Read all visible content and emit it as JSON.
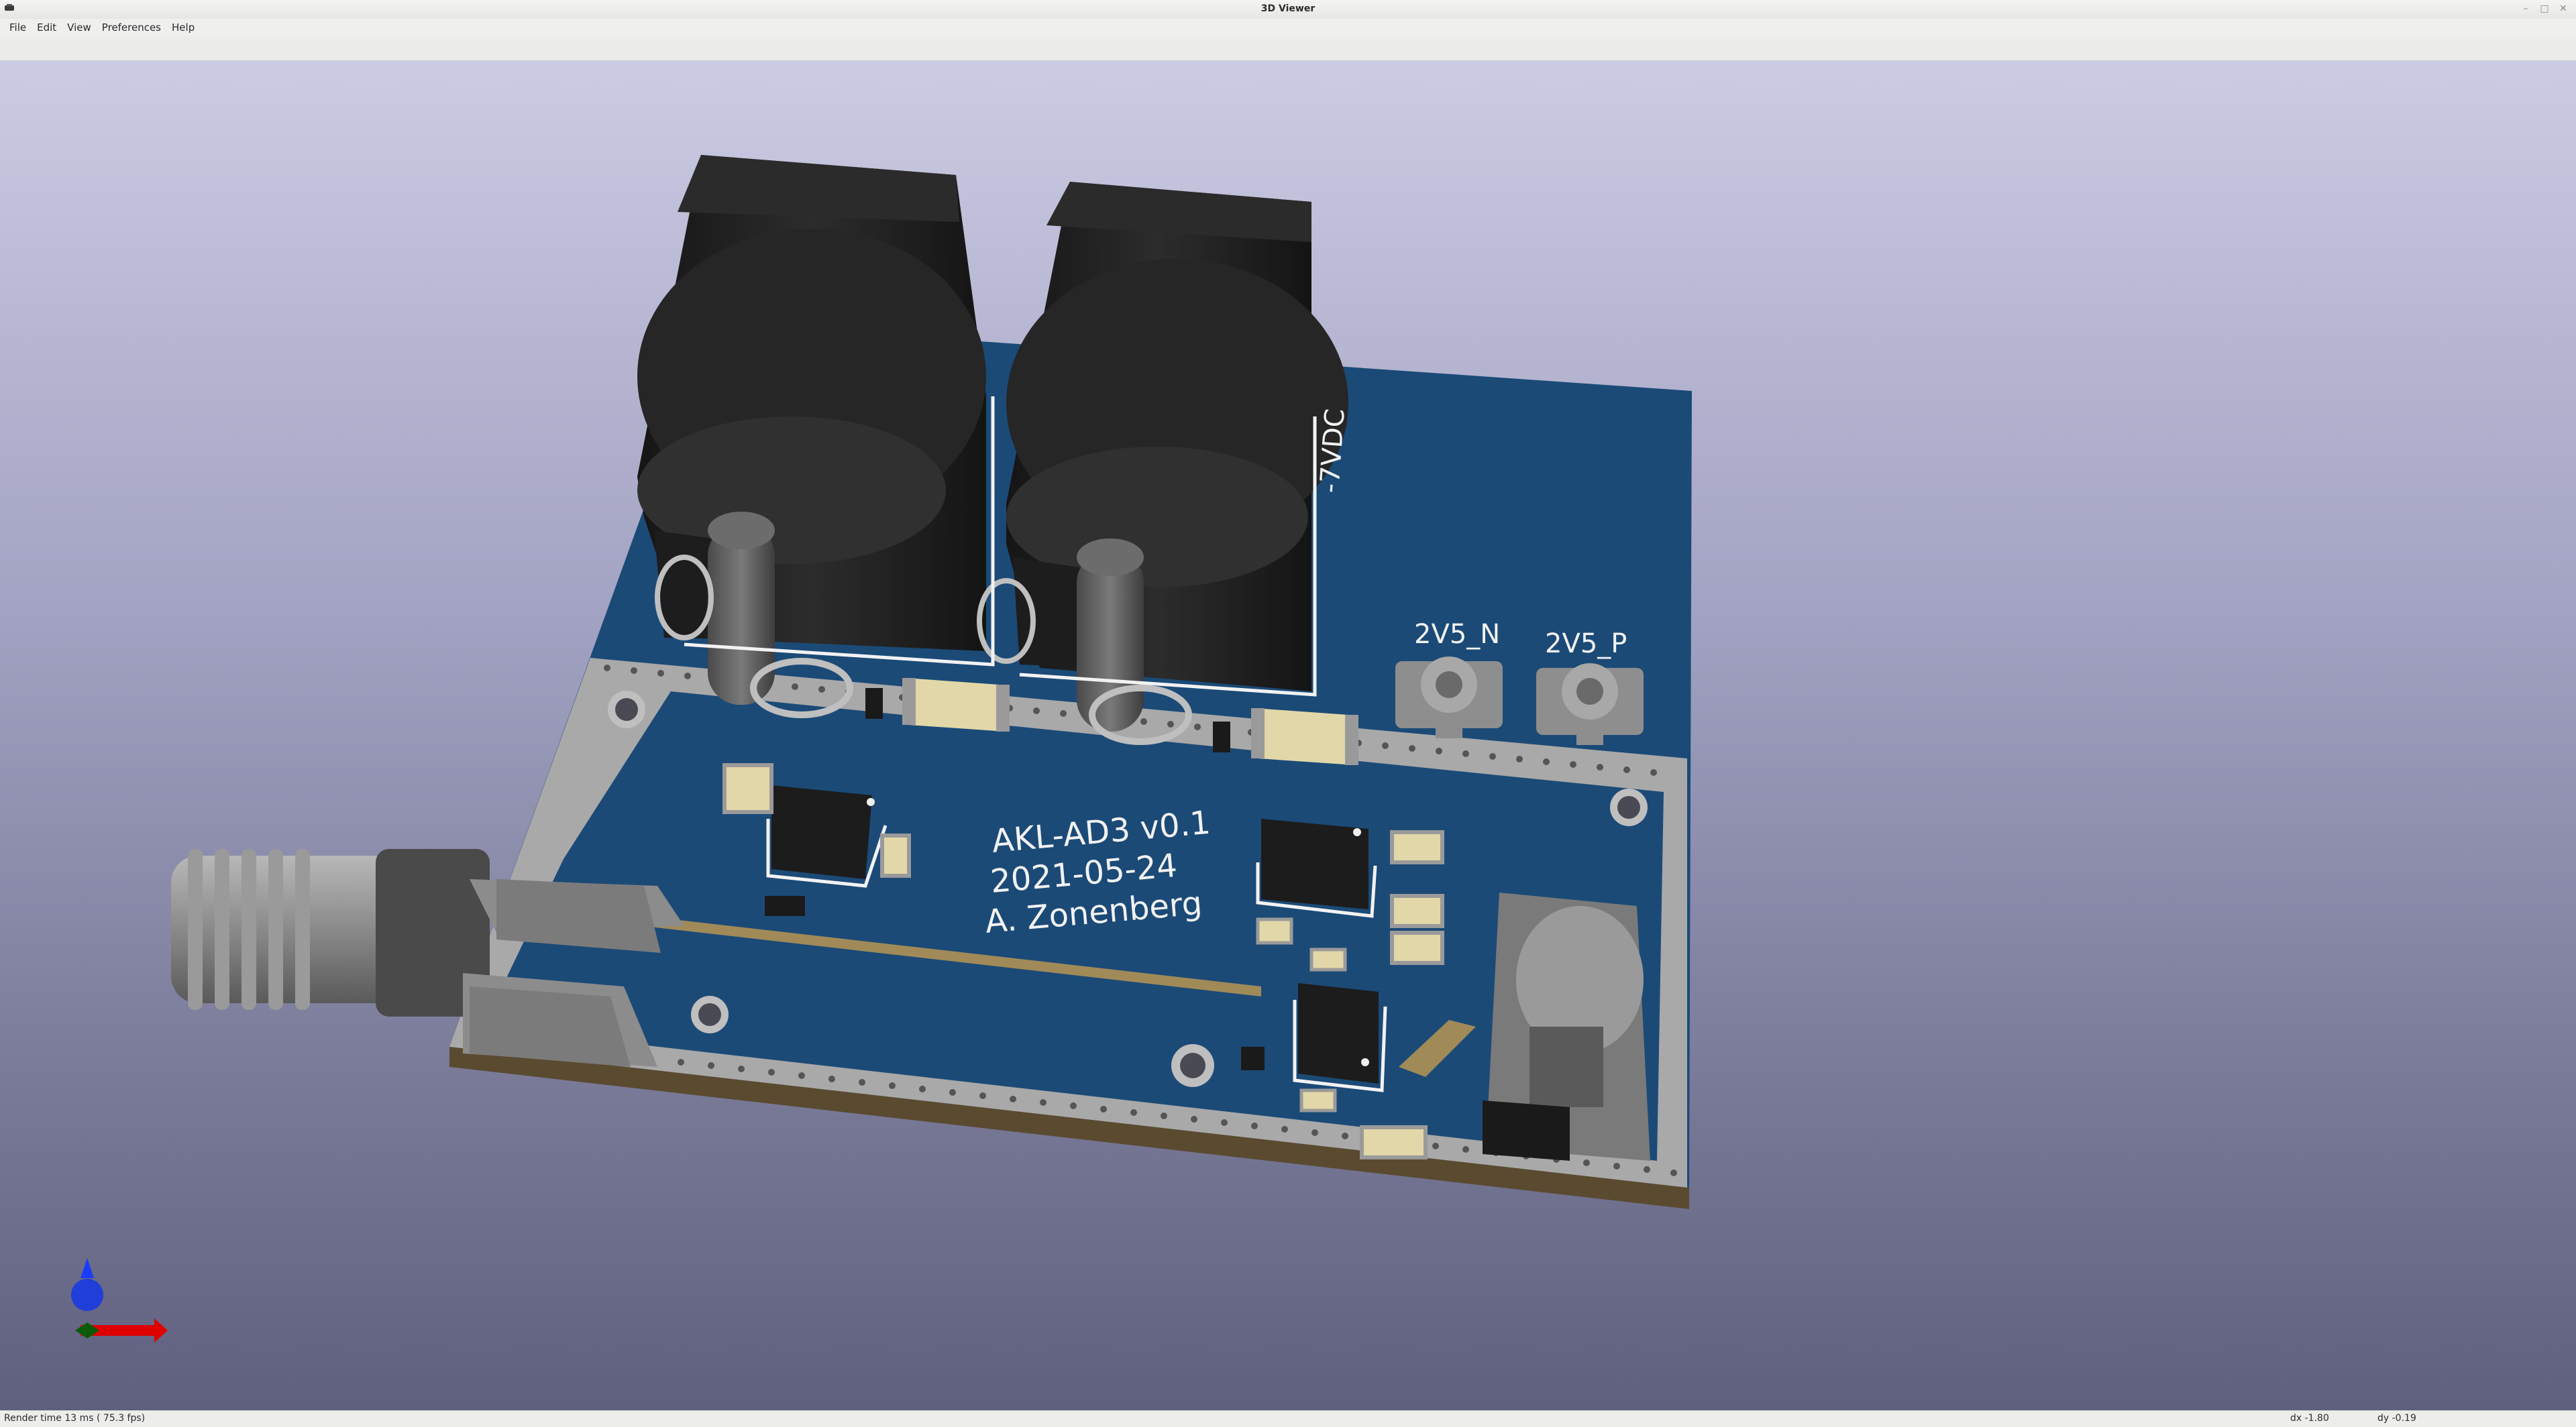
{
  "window": {
    "title": "3D Viewer",
    "controls": [
      "minimize",
      "maximize",
      "close"
    ]
  },
  "menu": {
    "items": [
      "File",
      "Edit",
      "View",
      "Preferences",
      "Help"
    ]
  },
  "board": {
    "title": "AKL-AD3 v0.1",
    "date": "2021-05-24",
    "author": "A. Zonenberg",
    "labels": {
      "voltage": "-7VDC",
      "conn_n": "2V5_N",
      "conn_p": "2V5_P"
    }
  },
  "colors": {
    "pcb": "#1b4a77",
    "silkscreen": "#f2f2f2",
    "jack": "#1e1e1e",
    "background_top": "#cbcbe3",
    "background_bottom": "#5f5f7e"
  },
  "status": {
    "render": "Render time 13 ms ( 75.3 fps)",
    "dx": "dx -1.80",
    "dy": "dy -0.19"
  },
  "icons": {
    "app": "kicad-3d-icon",
    "axis": "axis-gizmo-icon"
  }
}
